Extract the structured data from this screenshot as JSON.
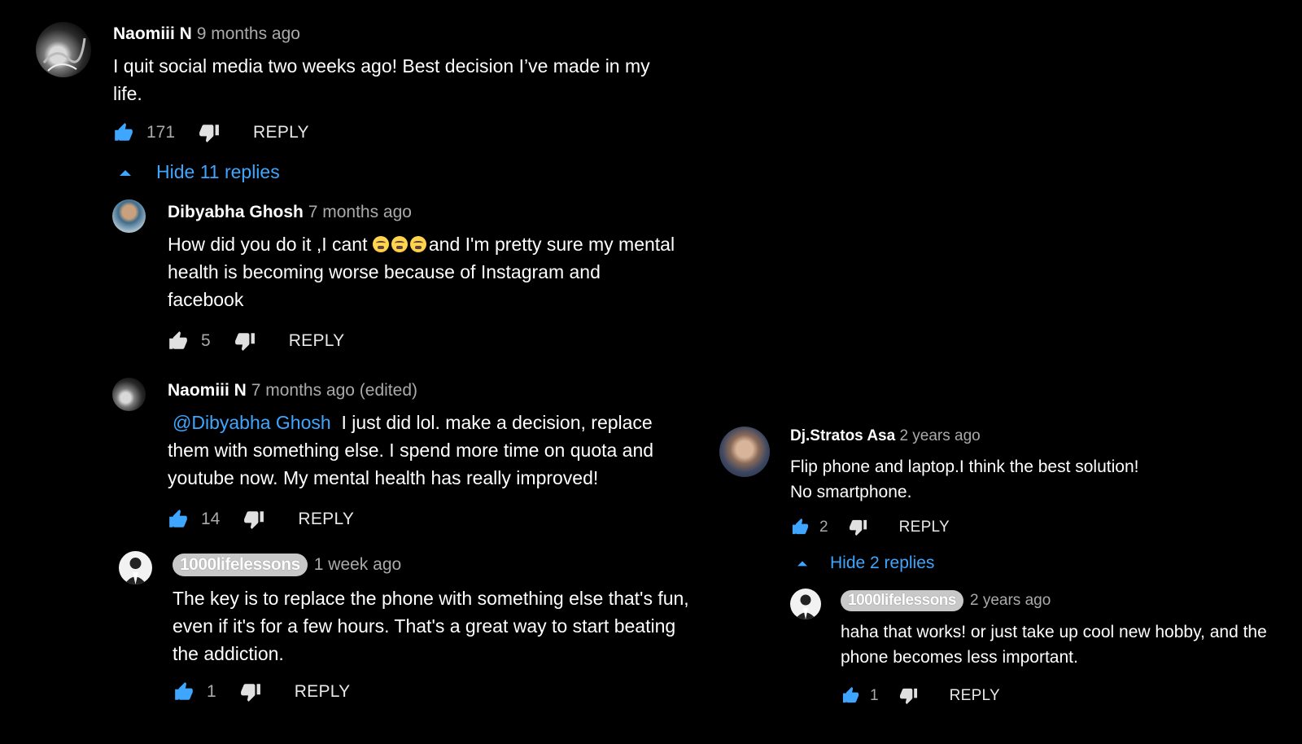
{
  "comments": [
    {
      "author": "Naomiii N",
      "time": "9 months ago",
      "body_lines": [
        "I quit social media two weeks ago! Best decision I’ve made in my",
        "life."
      ],
      "likes": "171",
      "reply_label": "REPLY",
      "toggle_label": "Hide 11 replies",
      "replies": [
        {
          "author": "Dibyabha Ghosh",
          "time": "7 months ago",
          "body_prefix": "How did you do it ,I cant ",
          "body_suffix": "and I'm pretty sure my mental",
          "body_lines": [
            "health is becoming worse because of Instagram and",
            "facebook"
          ],
          "emoji": "crying-face-emoji",
          "likes": "5",
          "reply_label": "REPLY"
        },
        {
          "author": "Naomiii N",
          "time": "7 months ago (edited)",
          "mention": "@Dibyabha Ghosh",
          "body_first": "I just did lol. make a decision, replace",
          "body_lines": [
            "them with something else. I spend more time on quota and",
            "youtube now. My mental health has really improved!"
          ],
          "likes": "14",
          "reply_label": "REPLY"
        },
        {
          "author": "1000lifelessons",
          "time": "1 week ago",
          "body_lines": [
            "The key is to replace the phone with something else that's fun,",
            "even if it's for a few hours. That's a great way to start beating",
            "the addiction."
          ],
          "likes": "1",
          "reply_label": "REPLY"
        }
      ]
    },
    {
      "author": "Dj.Stratos Asa",
      "time": "2 years ago",
      "body_lines": [
        "Flip phone and laptop.I think the best solution!",
        "No smartphone."
      ],
      "likes": "2",
      "reply_label": "REPLY",
      "toggle_label": "Hide 2 replies",
      "replies": [
        {
          "author": "1000lifelessons",
          "time": "2 years ago",
          "body_lines": [
            "haha that works! or just take up cool new hobby, and the",
            "phone becomes less important."
          ],
          "likes": "1",
          "reply_label": "REPLY"
        }
      ]
    }
  ],
  "colors": {
    "accent": "#3ea6ff",
    "background": "#000000",
    "muted": "#aaaaaa"
  }
}
